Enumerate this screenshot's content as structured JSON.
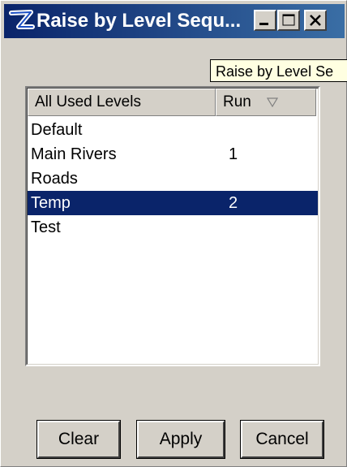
{
  "window": {
    "title": "Raise by Level Sequ...",
    "icon": "microstation-app-icon",
    "controls": {
      "minimize": "minimize-icon",
      "maximize": "maximize-icon",
      "close": "close-icon"
    }
  },
  "tooltip": {
    "text": "Raise by Level Se"
  },
  "list": {
    "columns": [
      "All Used Levels",
      "Run"
    ],
    "sort_indicator": "sort-down-icon",
    "rows": [
      {
        "level": "Default",
        "run": ""
      },
      {
        "level": "Main Rivers",
        "run": "1"
      },
      {
        "level": "Roads",
        "run": ""
      },
      {
        "level": "Temp",
        "run": "2"
      },
      {
        "level": "Test",
        "run": ""
      }
    ],
    "selected_index": 3
  },
  "buttons": {
    "clear": "Clear",
    "apply": "Apply",
    "cancel": "Cancel"
  },
  "colors": {
    "titlebar": "#0a246a",
    "selection": "#0a246a",
    "face": "#d4d0c8",
    "tooltip_bg": "#ffffe1"
  }
}
